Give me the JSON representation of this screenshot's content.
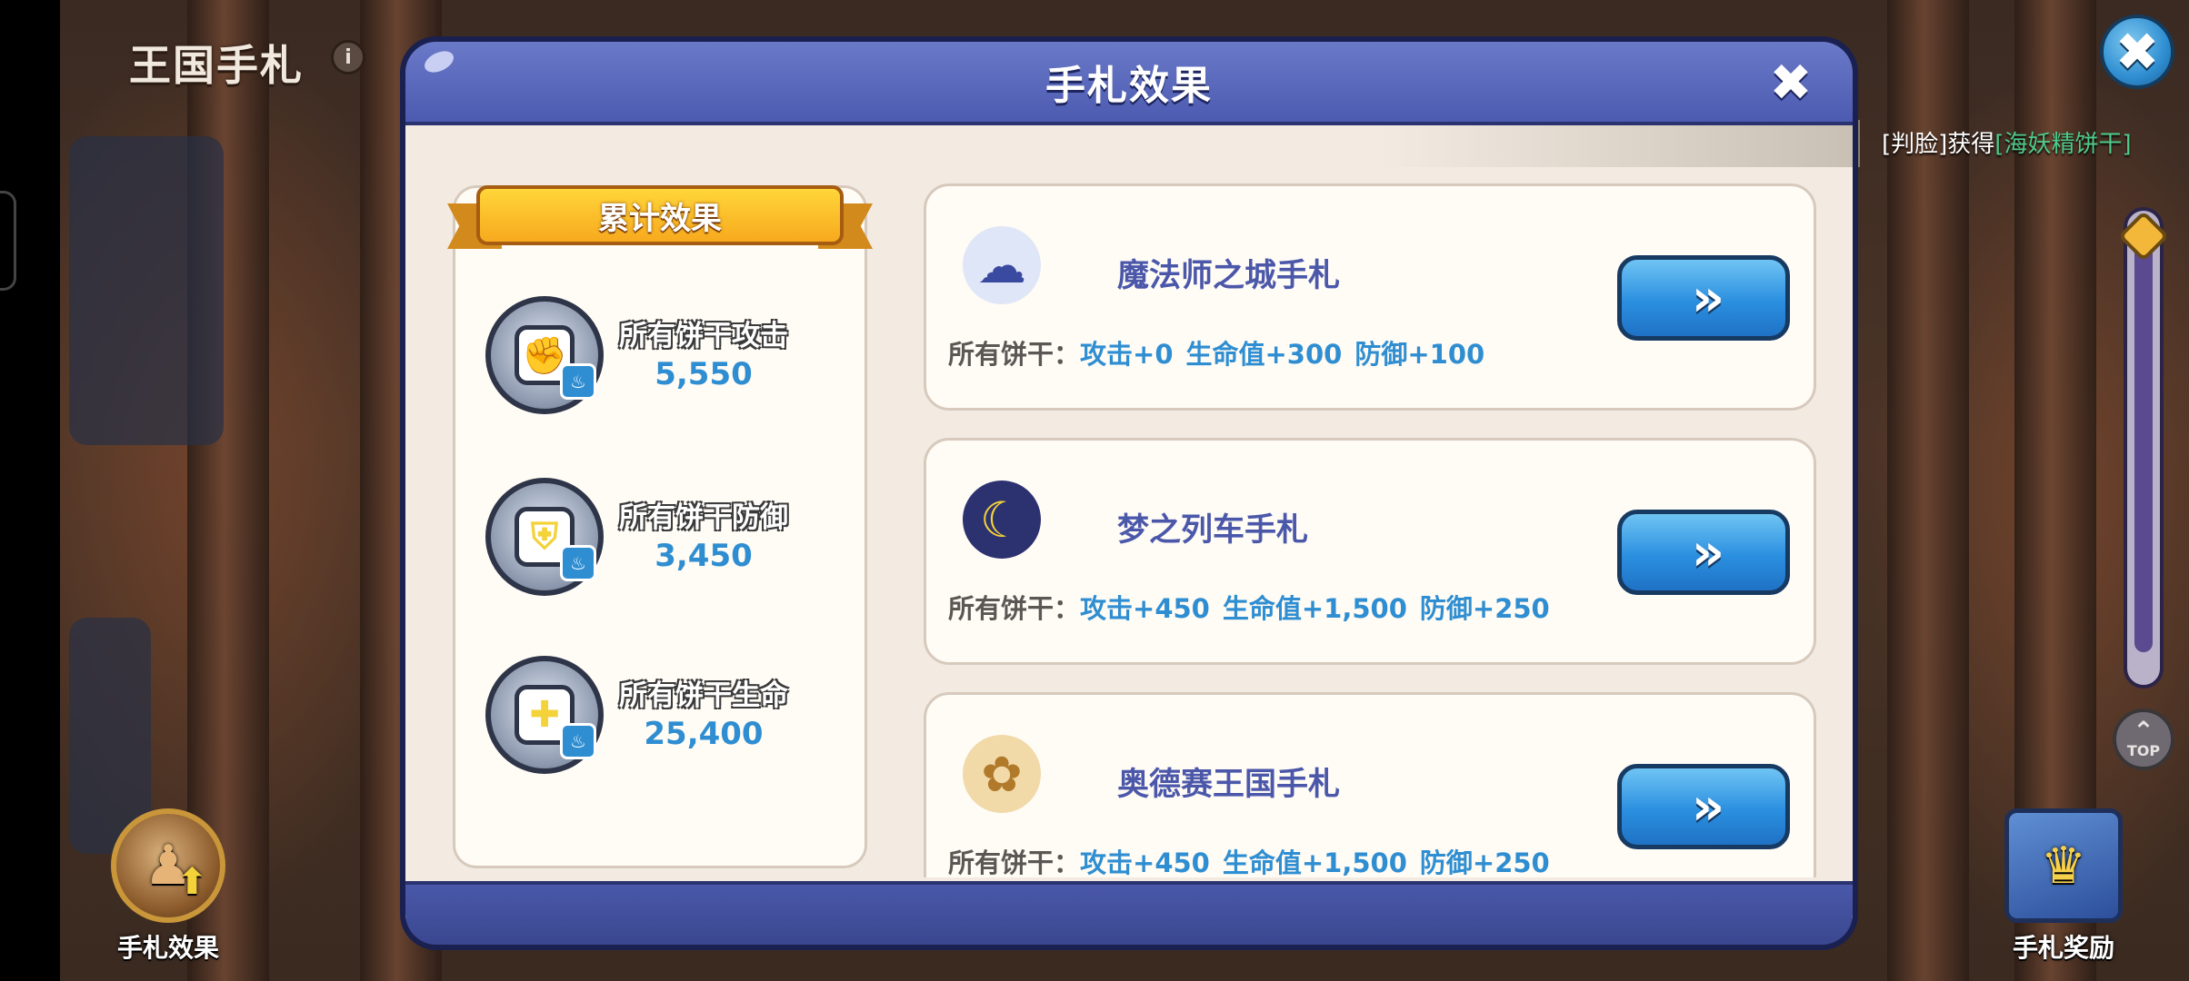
{
  "kingdom": {
    "title": "王国手札",
    "info_symbol": "i",
    "close_symbol": "✖"
  },
  "chat": {
    "prefix": "[判脸]获得",
    "highlight": "[海妖精饼干]"
  },
  "scroll": {
    "top_label": "TOP"
  },
  "side_buttons": {
    "left_label": "手札效果",
    "right_label": "手札奖励"
  },
  "modal": {
    "title": "手札效果",
    "close_symbol": "✖",
    "cumulative_title": "累计效果",
    "stats": [
      {
        "label": "所有饼干攻击",
        "value": "5,550",
        "icon": "fist-icon"
      },
      {
        "label": "所有饼干防御",
        "value": "3,450",
        "icon": "shield-icon"
      },
      {
        "label": "所有饼干生命",
        "value": "25,400",
        "icon": "health-cross-icon"
      }
    ],
    "journals": [
      {
        "name": "魔法师之城手札",
        "prefix": "所有饼干：",
        "attack": "攻击+0",
        "hp": "生命值+300",
        "defense": "防御+100",
        "button": "»"
      },
      {
        "name": "梦之列车手札",
        "prefix": "所有饼干：",
        "attack": "攻击+450",
        "hp": "生命值+1,500",
        "defense": "防御+250",
        "button": "»"
      },
      {
        "name": "奥德赛王国手札",
        "prefix": "所有饼干：",
        "attack": "攻击+450",
        "hp": "生命值+1,500",
        "defense": "防御+250",
        "button": "»"
      }
    ]
  },
  "colors": {
    "accent_blue": "#2f8ed1",
    "header_purple": "#4c5bb0",
    "ribbon_gold": "#f7a91d",
    "journal_name": "#4b58aa"
  }
}
